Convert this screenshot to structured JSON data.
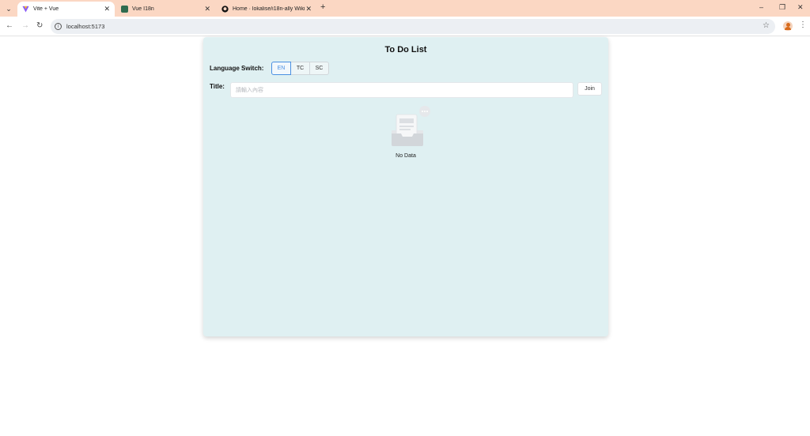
{
  "browser": {
    "tabs": [
      {
        "title": "Vite + Vue",
        "favicon_color": "#8b5cf6",
        "active": true
      },
      {
        "title": "Vue I18n",
        "favicon_color": "#2f6b4f",
        "active": false
      },
      {
        "title": "Home · lokalise/i18n-ally Wiki",
        "favicon_color": "#111111",
        "active": false
      }
    ],
    "new_tab_glyph": "+",
    "close_glyph": "✕",
    "url": "localhost:5173",
    "chrome_color": "#fbd7c3"
  },
  "app": {
    "title": "To Do List",
    "language_label": "Language Switch:",
    "languages": [
      "EN",
      "TC",
      "SC"
    ],
    "selected_language": "EN",
    "title_label": "Title:",
    "input_placeholder": "請輸入內容",
    "join_label": "Join",
    "empty_text": "No Data",
    "accent_color": "#4a90e2",
    "card_color": "#dff0f2"
  }
}
